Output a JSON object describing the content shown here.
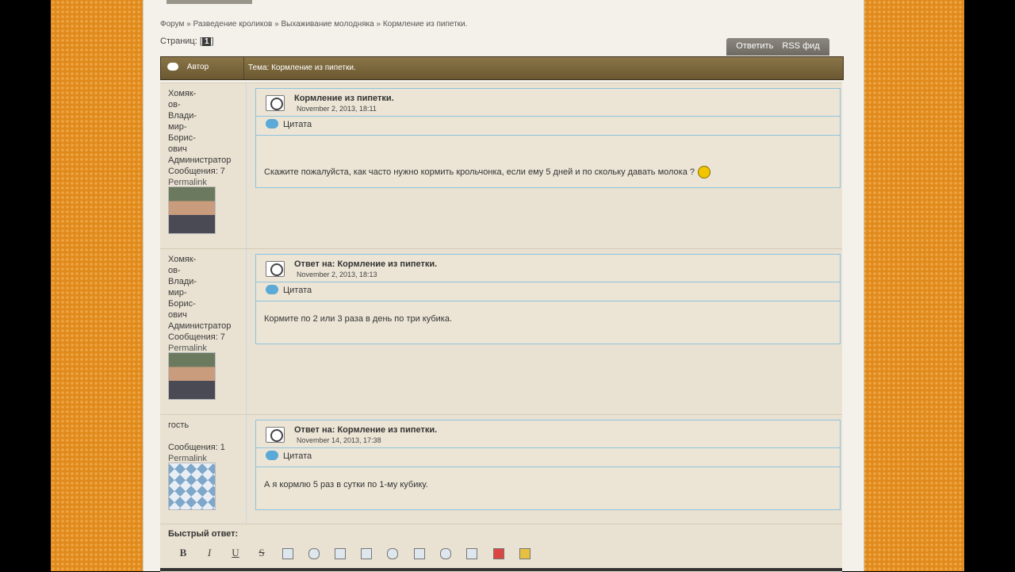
{
  "breadcrumb": {
    "items": [
      "Форум",
      "Разведение кроликов",
      "Выхаживание молодняка",
      "Кормление из пипетки."
    ],
    "separator": "»"
  },
  "pages": {
    "label": "Страниц:",
    "current": "1"
  },
  "top_tabs": {
    "reply": "Ответить",
    "rss": "RSS фид"
  },
  "thread_header": {
    "author_label": "Автор",
    "topic": "Тема: Кормление из пипетки."
  },
  "posts": [
    {
      "name_lines": [
        "Хомяк-",
        "ов-",
        "Влади-",
        "мир-",
        "Борис-",
        "ович"
      ],
      "role": "Администратор",
      "count": "Сообщения: 7",
      "permalink": "Permalink",
      "title": "Кормление из пипетки.",
      "date": "November 2, 2013, 18:11",
      "quote": "Цитата",
      "body": "Скажите пожалуйста, как часто нужно кормить крольчонка, если ему 5 дней и по скольку давать молока ?"
    },
    {
      "name_lines": [
        "Хомяк-",
        "ов-",
        "Влади-",
        "мир-",
        "Борис-",
        "ович"
      ],
      "role": "Администратор",
      "count": "Сообщения: 7",
      "permalink": "Permalink",
      "title": "Ответ на: Кормление из пипетки.",
      "date": "November 2, 2013, 18:13",
      "quote": "Цитата",
      "body": "Кормите по 2 или 3 раза в день по три кубика."
    },
    {
      "name_lines": [
        "гость"
      ],
      "role": "",
      "count": "Сообщения: 1",
      "permalink": "Permalink",
      "title": "Ответ на: Кормление из пипетки.",
      "date": "November 14, 2013, 17:38",
      "quote": "Цитата",
      "body": "А я кормлю 5 раз в сутки по 1-му кубику."
    }
  ],
  "quick_reply": {
    "label": "Быстрый ответ:",
    "toolbar": [
      "B",
      "I",
      "U",
      "S"
    ]
  }
}
